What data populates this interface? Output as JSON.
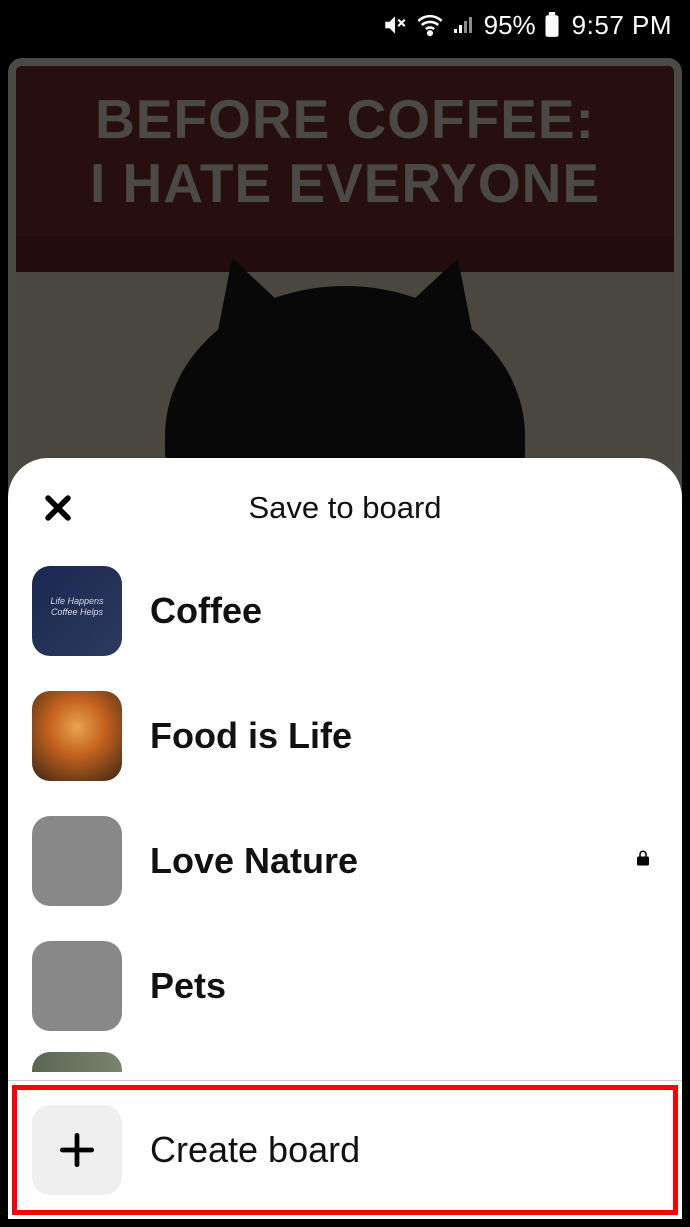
{
  "status": {
    "battery_pct": "95%",
    "time": "9:57 PM"
  },
  "poster": {
    "line1": "BEFORE COFFEE:",
    "line2": "I HATE EVERYONE"
  },
  "sheet": {
    "title": "Save to board",
    "boards": [
      {
        "label": "Coffee",
        "thumb": "coffee",
        "locked": false
      },
      {
        "label": "Food is Life",
        "thumb": "food",
        "locked": false
      },
      {
        "label": "Love Nature",
        "thumb": "gray",
        "locked": true
      },
      {
        "label": "Pets",
        "thumb": "gray",
        "locked": false
      }
    ],
    "create_label": "Create board"
  }
}
